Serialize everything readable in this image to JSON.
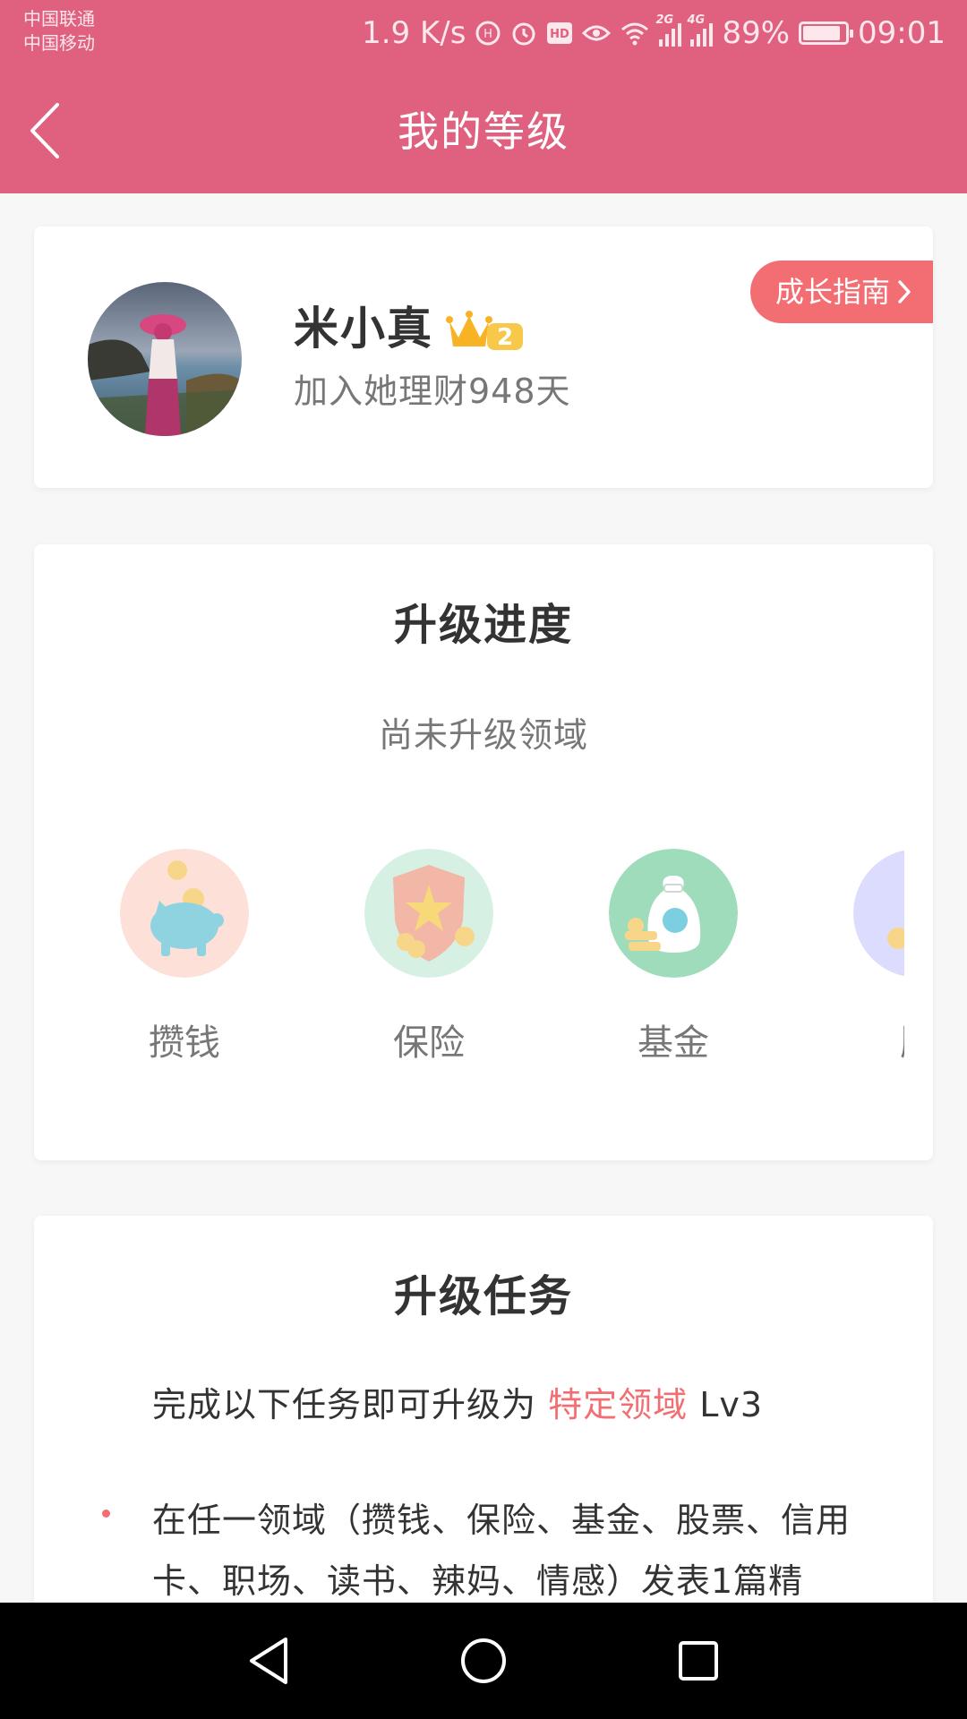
{
  "status_bar": {
    "carrier_1": "中国联通",
    "carrier_2": "中国移动",
    "net_speed": "1.9 K/s",
    "signal_1_tag": "2G",
    "signal_2_tag": "4G",
    "battery_percent": "89%",
    "battery_level": 0.89,
    "time": "09:01",
    "icons": [
      "speed-icon",
      "leaf-icon",
      "alarm-icon",
      "hd-icon",
      "eye-icon",
      "wifi-icon",
      "signal-icon",
      "signal-icon",
      "battery-icon"
    ]
  },
  "header": {
    "title": "我的等级",
    "background": "#e0607f"
  },
  "profile": {
    "name": "米小真",
    "level": "2",
    "join_text": "加入她理财948天",
    "guide_button": "成长指南"
  },
  "progress": {
    "title": "升级进度",
    "subtitle": "尚未升级领域",
    "domains": [
      {
        "label": "攒钱",
        "icon": "piggy-bank-icon"
      },
      {
        "label": "保险",
        "icon": "shield-icon"
      },
      {
        "label": "基金",
        "icon": "money-bag-icon"
      },
      {
        "label": "股",
        "icon": "stock-icon"
      }
    ]
  },
  "tasks": {
    "title": "升级任务",
    "intro_prefix": "完成以下任务即可升级为 ",
    "intro_highlight": "特定领域",
    "intro_suffix": " Lv3",
    "items": [
      "在任一领域（攒钱、保险、基金、股票、信用卡、职场、读书、辣妈、情感）发表1篇精"
    ]
  },
  "colors": {
    "accent": "#e0607f",
    "highlight": "#f26e73",
    "text_primary": "#333333",
    "text_secondary": "#777777"
  }
}
